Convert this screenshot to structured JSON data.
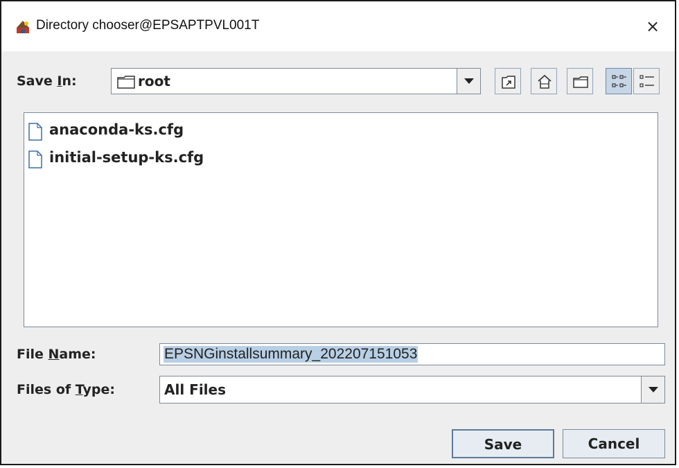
{
  "window": {
    "title": "Directory chooser@EPSAPTPVL001T",
    "close_symbol": "×"
  },
  "save_in": {
    "label_pre": "Save ",
    "label_mnemonic": "I",
    "label_post": "n:",
    "selected": "root"
  },
  "toolbar": {
    "buttons": [
      {
        "icon": "up-one-level-icon"
      },
      {
        "icon": "home-icon"
      },
      {
        "icon": "new-folder-icon"
      },
      {
        "icon": "list-view-icon",
        "pressed": true
      },
      {
        "icon": "details-view-icon",
        "pressed": false
      }
    ]
  },
  "files": [
    {
      "name": "anaconda-ks.cfg"
    },
    {
      "name": "initial-setup-ks.cfg"
    }
  ],
  "file_name": {
    "label_pre": "File ",
    "label_mnemonic": "N",
    "label_post": "ame:",
    "value": "EPSNGinstallsummary_202207151053"
  },
  "files_of_type": {
    "label_pre": "Files of ",
    "label_mnemonic": "T",
    "label_post": "ype:",
    "selected": "All Files"
  },
  "buttons": {
    "save": "Save",
    "cancel": "Cancel"
  }
}
